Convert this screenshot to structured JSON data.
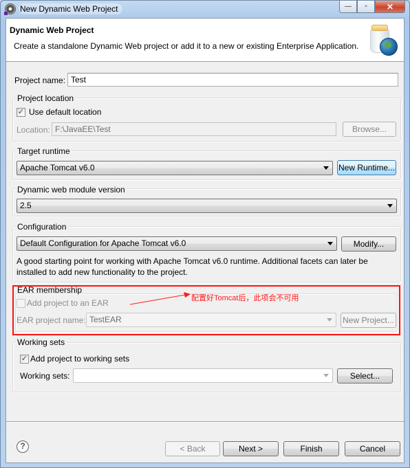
{
  "window": {
    "title": "New Dynamic Web Project",
    "controls": {
      "minimize": "—",
      "maximize": "▫",
      "close": "✕"
    }
  },
  "header": {
    "title": "Dynamic Web Project",
    "description": "Create a standalone Dynamic Web project or add it to a new or existing Enterprise Application."
  },
  "project_name": {
    "label": "Project name:",
    "value": "Test"
  },
  "project_location": {
    "group_label": "Project location",
    "use_default_label": "Use default location",
    "use_default_checked": true,
    "location_label": "Location:",
    "location_value": "F:\\JavaEE\\Test",
    "browse_label": "Browse..."
  },
  "target_runtime": {
    "group_label": "Target runtime",
    "selected": "Apache Tomcat v6.0",
    "new_runtime_label": "New Runtime..."
  },
  "module_version": {
    "group_label": "Dynamic web module version",
    "selected": "2.5"
  },
  "configuration": {
    "group_label": "Configuration",
    "selected": "Default Configuration for Apache Tomcat v6.0",
    "modify_label": "Modify...",
    "description_line1": "A good starting point for working with Apache Tomcat v6.0 runtime. Additional facets can later be",
    "description_line2": "installed to add new functionality to the project."
  },
  "ear_membership": {
    "group_label": "EAR membership",
    "add_to_ear_label": "Add project to an EAR",
    "add_to_ear_checked": false,
    "ear_name_label": "EAR project name:",
    "ear_name_value": "TestEAR",
    "new_project_label": "New Project..."
  },
  "annotation": {
    "text": "配置好Tomcat后，此项会不可用",
    "color": "#ff0000"
  },
  "working_sets": {
    "group_label": "Working sets",
    "add_label": "Add project to working sets",
    "add_checked": true,
    "sets_label": "Working sets:",
    "sets_value": "",
    "select_label": "Select..."
  },
  "footer": {
    "help_icon": "?",
    "back_label": "< Back",
    "next_label": "Next >",
    "finish_label": "Finish",
    "cancel_label": "Cancel"
  }
}
